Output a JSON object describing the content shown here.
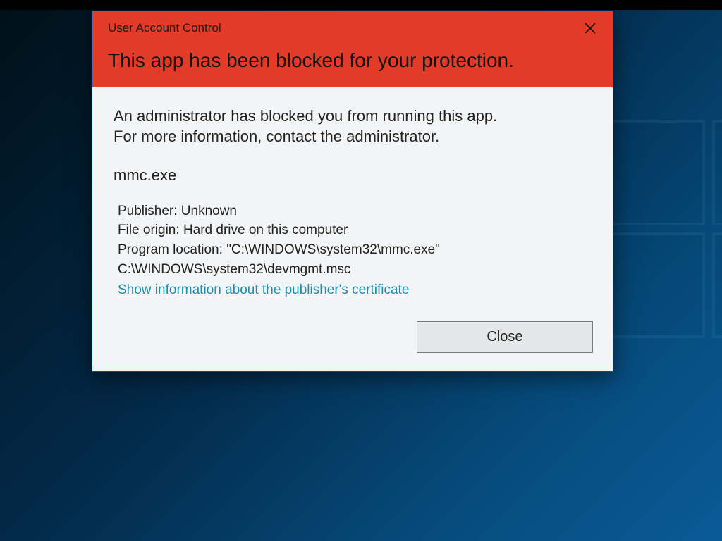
{
  "dialog": {
    "title_small": "User Account Control",
    "title_big": "This app has been blocked for your protection.",
    "close_icon_name": "close-icon"
  },
  "body": {
    "message": "An administrator has blocked you from running this app. For more information, contact the administrator.",
    "app_name": "mmc.exe",
    "details": {
      "publisher_label": "Publisher:",
      "publisher_value": "Unknown",
      "origin_label": "File origin:",
      "origin_value": "Hard drive on this computer",
      "location_label": "Program location:",
      "location_value": "\"C:\\WINDOWS\\system32\\mmc.exe\" C:\\WINDOWS\\system32\\devmgmt.msc"
    },
    "cert_link": "Show information about the publisher's certificate"
  },
  "footer": {
    "close_label": "Close"
  },
  "colors": {
    "header_bg": "#e23c28",
    "link": "#1a8da8"
  }
}
